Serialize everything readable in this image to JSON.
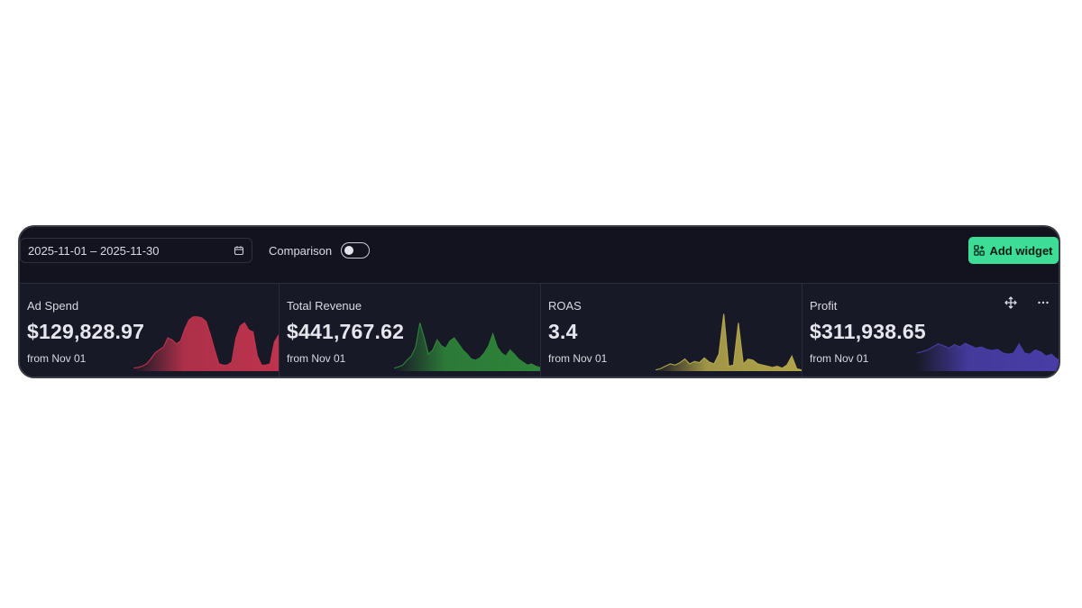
{
  "toolbar": {
    "date_range": "2025-11-01 – 2025-11-30",
    "comparison_label": "Comparison",
    "comparison_on": false,
    "add_widget_label": "Add widget",
    "accent_color": "#3ddc97"
  },
  "cards": [
    {
      "label": "Ad Spend",
      "value": "$129,828.97",
      "sub": "from Nov 01",
      "color": "#c7344f",
      "series": [
        0.05,
        0.06,
        0.08,
        0.12,
        0.2,
        0.3,
        0.35,
        0.4,
        0.55,
        0.52,
        0.45,
        0.5,
        0.7,
        0.85,
        0.9,
        0.9,
        0.88,
        0.82,
        0.6,
        0.35,
        0.12,
        0.1,
        0.1,
        0.15,
        0.55,
        0.75,
        0.8,
        0.68,
        0.65,
        0.25,
        0.1,
        0.1,
        0.12,
        0.48,
        0.6
      ]
    },
    {
      "label": "Total Revenue",
      "value": "$441,767.62",
      "sub": "from Nov 01",
      "color": "#2f8a3a",
      "series": [
        0.05,
        0.07,
        0.1,
        0.18,
        0.25,
        0.4,
        0.8,
        0.55,
        0.28,
        0.35,
        0.52,
        0.42,
        0.38,
        0.5,
        0.55,
        0.45,
        0.35,
        0.28,
        0.2,
        0.18,
        0.22,
        0.3,
        0.42,
        0.62,
        0.4,
        0.3,
        0.25,
        0.35,
        0.28,
        0.2,
        0.15,
        0.1,
        0.12,
        0.08,
        0.06
      ]
    },
    {
      "label": "ROAS",
      "value": "3.4",
      "sub": "from Nov 01",
      "color": "#b8ab4c",
      "series": [
        0.02,
        0.04,
        0.08,
        0.12,
        0.1,
        0.14,
        0.2,
        0.12,
        0.16,
        0.14,
        0.22,
        0.15,
        0.12,
        0.28,
        0.95,
        0.08,
        0.1,
        0.8,
        0.12,
        0.2,
        0.18,
        0.12,
        0.1,
        0.08,
        0.06,
        0.08,
        0.05,
        0.1,
        0.25,
        0.04,
        0.02
      ]
    },
    {
      "label": "Profit",
      "value": "$311,938.65",
      "sub": "from Nov 01",
      "color": "#4b3fae",
      "series": [
        0.3,
        0.32,
        0.35,
        0.4,
        0.45,
        0.42,
        0.38,
        0.44,
        0.4,
        0.46,
        0.42,
        0.38,
        0.4,
        0.36,
        0.34,
        0.36,
        0.3,
        0.28,
        0.3,
        0.45,
        0.3,
        0.28,
        0.35,
        0.32,
        0.25,
        0.28,
        0.2,
        0.18
      ]
    }
  ]
}
